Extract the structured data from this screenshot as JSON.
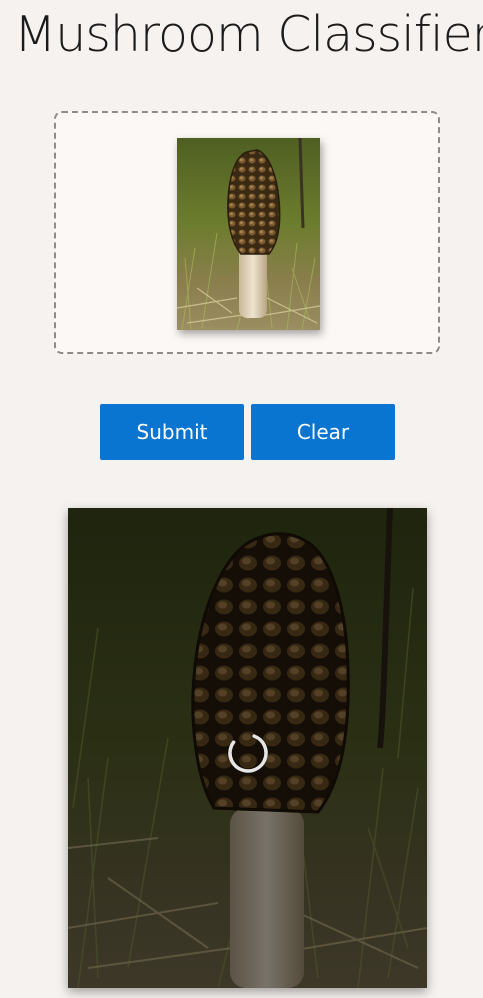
{
  "app": {
    "title": "Mushroom Classifier"
  },
  "upload": {
    "image_alt": "morel-mushroom-photo"
  },
  "actions": {
    "submit_label": "Submit",
    "clear_label": "Clear"
  },
  "result": {
    "status": "loading",
    "image_alt": "morel-mushroom-photo"
  },
  "colors": {
    "background": "#f6f2ef",
    "accent": "#0a74d1",
    "dropzone_border": "#8c8c8c"
  }
}
